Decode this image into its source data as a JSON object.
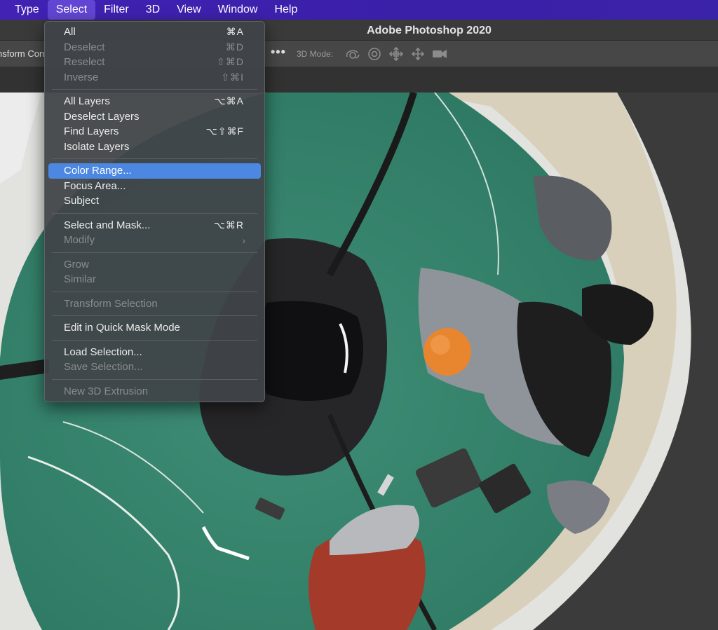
{
  "menubar": {
    "items": [
      {
        "label": "Type"
      },
      {
        "label": "Select"
      },
      {
        "label": "Filter"
      },
      {
        "label": "3D"
      },
      {
        "label": "View"
      },
      {
        "label": "Window"
      },
      {
        "label": "Help"
      }
    ],
    "active": "Select"
  },
  "titlebar": {
    "title": "Adobe Photoshop 2020"
  },
  "optionsbar": {
    "transform_label": "nsform Con",
    "more": "•••",
    "mode_label": "3D Mode:",
    "tool_icons": [
      "orbit-3d-icon",
      "roll-3d-icon",
      "drag-3d-icon",
      "slide-3d-icon",
      "camera-3d-icon"
    ]
  },
  "select_menu": {
    "groups": [
      [
        {
          "label": "All",
          "shortcut": "⌘A",
          "enabled": true
        },
        {
          "label": "Deselect",
          "shortcut": "⌘D",
          "enabled": false
        },
        {
          "label": "Reselect",
          "shortcut": "⇧⌘D",
          "enabled": false
        },
        {
          "label": "Inverse",
          "shortcut": "⇧⌘I",
          "enabled": false
        }
      ],
      [
        {
          "label": "All Layers",
          "shortcut": "⌥⌘A",
          "enabled": true
        },
        {
          "label": "Deselect Layers",
          "shortcut": "",
          "enabled": true
        },
        {
          "label": "Find Layers",
          "shortcut": "⌥⇧⌘F",
          "enabled": true
        },
        {
          "label": "Isolate Layers",
          "shortcut": "",
          "enabled": true
        }
      ],
      [
        {
          "label": "Color Range...",
          "shortcut": "",
          "enabled": true,
          "highlighted": true
        },
        {
          "label": "Focus Area...",
          "shortcut": "",
          "enabled": true
        },
        {
          "label": "Subject",
          "shortcut": "",
          "enabled": true
        }
      ],
      [
        {
          "label": "Select and Mask...",
          "shortcut": "⌥⌘R",
          "enabled": true
        },
        {
          "label": "Modify",
          "shortcut": "",
          "enabled": false,
          "submenu": true
        }
      ],
      [
        {
          "label": "Grow",
          "shortcut": "",
          "enabled": false
        },
        {
          "label": "Similar",
          "shortcut": "",
          "enabled": false
        }
      ],
      [
        {
          "label": "Transform Selection",
          "shortcut": "",
          "enabled": false
        }
      ],
      [
        {
          "label": "Edit in Quick Mask Mode",
          "shortcut": "",
          "enabled": true
        }
      ],
      [
        {
          "label": "Load Selection...",
          "shortcut": "",
          "enabled": true
        },
        {
          "label": "Save Selection...",
          "shortcut": "",
          "enabled": false
        }
      ],
      [
        {
          "label": "New 3D Extrusion",
          "shortcut": "",
          "enabled": false
        }
      ]
    ]
  },
  "colors": {
    "menubar": "#3f22b0",
    "highlight": "#4c88e2",
    "mat_green": "#3f8a72"
  }
}
